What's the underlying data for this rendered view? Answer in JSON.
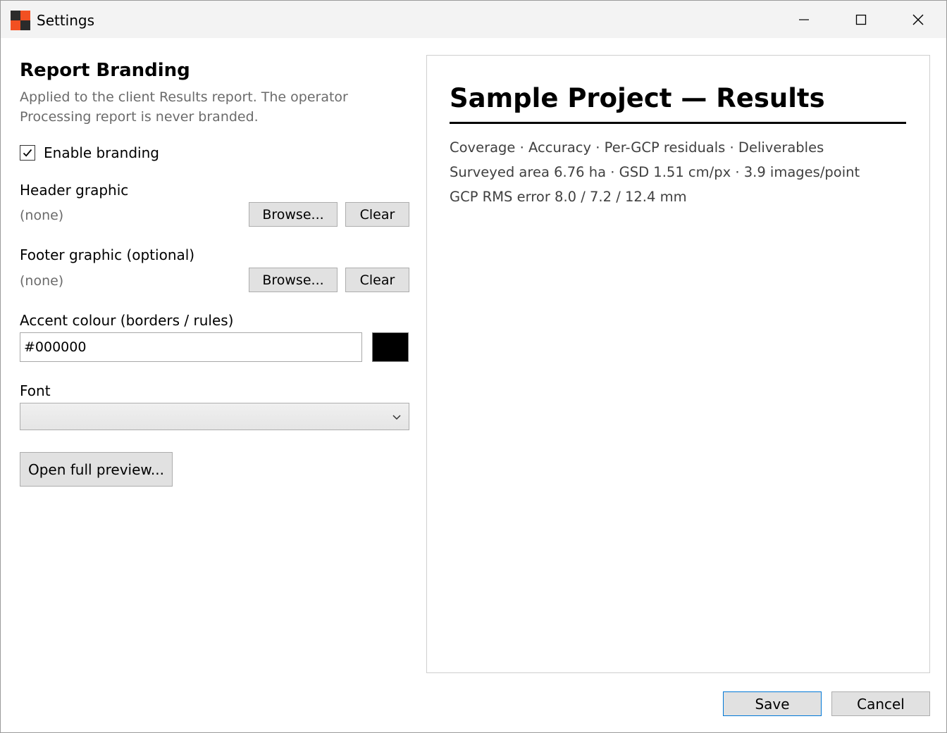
{
  "window": {
    "title": "Settings"
  },
  "branding": {
    "title": "Report Branding",
    "description": "Applied to the client Results report. The operator Processing report is never branded.",
    "enable_label": "Enable branding",
    "enable_checked": true,
    "header_label": "Header graphic",
    "header_value": "(none)",
    "footer_label": "Footer graphic (optional)",
    "footer_value": "(none)",
    "browse_label": "Browse...",
    "clear_label": "Clear",
    "accent_label": "Accent colour (borders / rules)",
    "accent_value": "#000000",
    "font_label": "Font",
    "font_value": "",
    "open_preview_label": "Open full preview..."
  },
  "preview": {
    "title": "Sample Project — Results",
    "lines": [
      "Coverage · Accuracy · Per-GCP residuals · Deliverables",
      "Surveyed area 6.76 ha · GSD 1.51 cm/px · 3.9 images/point",
      "GCP RMS error 8.0 / 7.2 / 12.4 mm"
    ]
  },
  "footer": {
    "save_label": "Save",
    "cancel_label": "Cancel"
  },
  "colors": {
    "accent": "#000000",
    "titlebar_bg": "#f3f3f3",
    "button_bg": "#e1e1e1",
    "primary_border": "#0078d7",
    "logo_orange": "#f25022",
    "logo_dark": "#2b2b2b"
  },
  "icons": {
    "app": "app-logo-icon",
    "minimize": "minimize-icon",
    "maximize": "maximize-icon",
    "close": "close-icon",
    "checkbox": "checkmark-icon",
    "dropdown": "chevron-down-icon"
  }
}
